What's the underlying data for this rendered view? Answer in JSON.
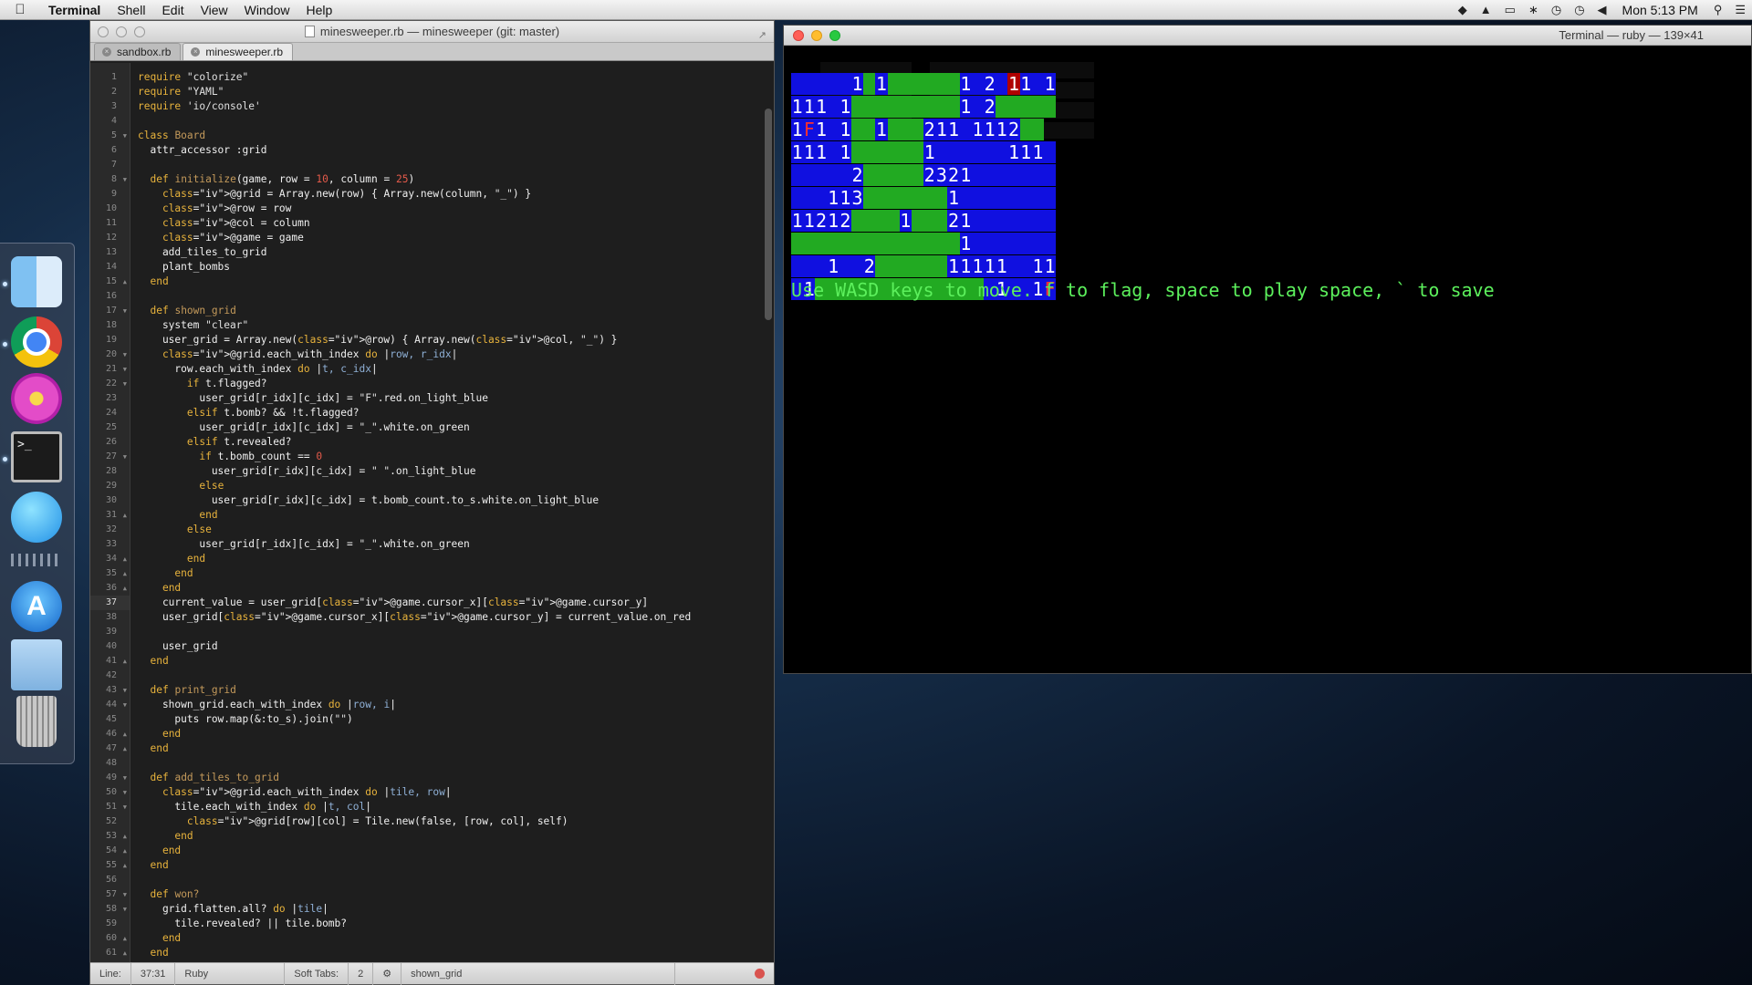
{
  "menubar": {
    "app_name": "Terminal",
    "items": [
      "Shell",
      "Edit",
      "View",
      "Window",
      "Help"
    ],
    "clock": "Mon 5:13 PM"
  },
  "dock": {
    "apps": [
      "finder",
      "chrome",
      "flower",
      "terminal",
      "messages",
      "app-store",
      "folder",
      "trash"
    ],
    "terminal_glyph": ">_"
  },
  "editor": {
    "title": "minesweeper.rb — minesweeper (git: master)",
    "tabs": [
      "sandbox.rb",
      "minesweeper.rb"
    ],
    "active_tab": 1,
    "status": {
      "line_label": "Line:",
      "position": "37:31",
      "language": "Ruby",
      "tabs_label": "Soft Tabs:",
      "tab_size": "2",
      "symbol": "shown_grid"
    },
    "current_line": 37,
    "lines": [
      "require \"colorize\"",
      "require \"YAML\"",
      "require 'io/console'",
      "",
      "class Board",
      "  attr_accessor :grid",
      "",
      "  def initialize(game, row = 10, column = 25)",
      "    @grid = Array.new(row) { Array.new(column, \"_\") }",
      "    @row = row",
      "    @col = column",
      "    @game = game",
      "    add_tiles_to_grid",
      "    plant_bombs",
      "  end",
      "",
      "  def shown_grid",
      "    system \"clear\"",
      "    user_grid = Array.new(@row) { Array.new(@col, \"_\") }",
      "    @grid.each_with_index do |row, r_idx|",
      "      row.each_with_index do |t, c_idx|",
      "        if t.flagged?",
      "          user_grid[r_idx][c_idx] = \"F\".red.on_light_blue",
      "        elsif t.bomb? && !t.flagged?",
      "          user_grid[r_idx][c_idx] = \"_\".white.on_green",
      "        elsif t.revealed?",
      "          if t.bomb_count == 0",
      "            user_grid[r_idx][c_idx] = \" \".on_light_blue",
      "          else",
      "            user_grid[r_idx][c_idx] = t.bomb_count.to_s.white.on_light_blue",
      "          end",
      "        else",
      "          user_grid[r_idx][c_idx] = \"_\".white.on_green",
      "        end",
      "      end",
      "    end",
      "    current_value = user_grid[@game.cursor_x][@game.cursor_y]",
      "    user_grid[@game.cursor_x][@game.cursor_y] = current_value.on_red",
      "",
      "    user_grid",
      "  end",
      "",
      "  def print_grid",
      "    shown_grid.each_with_index do |row, i|",
      "      puts row.map(&:to_s).join(\"\")",
      "    end",
      "  end",
      "",
      "  def add_tiles_to_grid",
      "    @grid.each_with_index do |tile, row|",
      "      tile.each_with_index do |t, col|",
      "        @grid[row][col] = Tile.new(false, [row, col], self)",
      "      end",
      "    end",
      "  end",
      "",
      "  def won?",
      "    grid.flatten.all? do |tile|",
      "      tile.revealed? || tile.bomb?",
      "    end",
      "  end"
    ]
  },
  "terminal": {
    "title": "Terminal — ruby — 139×41",
    "message": "Use WASD keys to move. f to flag, space to play space, ` to save",
    "board_rows": [
      "BBBBB1G1GGGGGG1B2BC1B1",
      "111B1GGGGGGGGG1B2GGGGG",
      "1F1B1GG1GGG211B1112GG",
      "111B1GGGGGG1BBBBBB111B",
      "BBBBB2GGGGG2321BBBBBBB",
      "BBB113GGGGGGG1BBBBBBBB",
      "11212GGGG1GGG21BBBBBBB",
      "GGGGGGGGGGGGGG1BBBBBBB",
      "BBB1BB2GGGGGG11111BB11",
      "B1GGGGGGGGGGGGGGB1BB1F"
    ]
  },
  "colors": {
    "term_blue": "#1010e0",
    "term_green": "#22aa22",
    "term_cursor": "#b00000",
    "term_message": "#5cf05c",
    "keyword": "#e8b33c",
    "ivar": "#8fb0d6",
    "number": "#e45a4a"
  }
}
